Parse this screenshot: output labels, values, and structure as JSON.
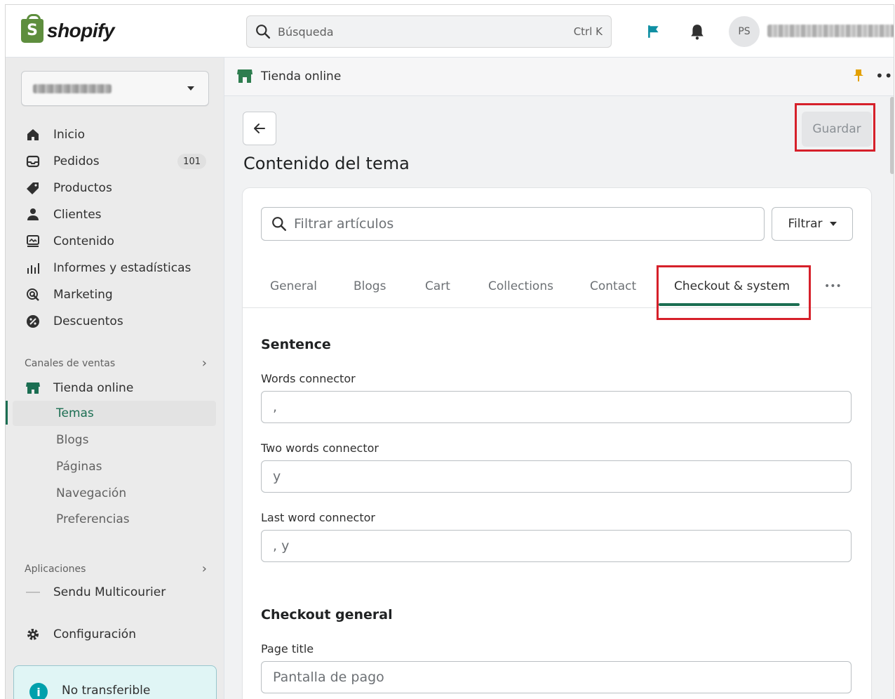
{
  "topbar": {
    "logo_text": "shopify",
    "logo_mark": "S",
    "search_placeholder": "Búsqueda",
    "search_shortcut": "Ctrl K",
    "avatar_initials": "PS",
    "accent": "#1b6e52"
  },
  "sidebar": {
    "items": [
      {
        "label": "Inicio",
        "icon": "home-icon"
      },
      {
        "label": "Pedidos",
        "icon": "orders-icon",
        "badge": "101"
      },
      {
        "label": "Productos",
        "icon": "tag-icon"
      },
      {
        "label": "Clientes",
        "icon": "person-icon"
      },
      {
        "label": "Contenido",
        "icon": "content-icon"
      },
      {
        "label": "Informes y estadísticas",
        "icon": "bar-chart-icon"
      },
      {
        "label": "Marketing",
        "icon": "target-icon"
      },
      {
        "label": "Descuentos",
        "icon": "discount-icon"
      }
    ],
    "sales_channels_label": "Canales de ventas",
    "online_store_label": "Tienda online",
    "sub_items": [
      "Temas",
      "Blogs",
      "Páginas",
      "Navegación",
      "Preferencias"
    ],
    "apps_label": "Aplicaciones",
    "app_item": "Sendu Multicourier",
    "settings_label": "Configuración",
    "banner_text": "No transferible"
  },
  "crumb": {
    "label": "Tienda online"
  },
  "page": {
    "title": "Contenido del tema",
    "save_label": "Guardar",
    "filter_placeholder": "Filtrar artículos",
    "filter_button": "Filtrar",
    "tabs": [
      "General",
      "Blogs",
      "Cart",
      "Collections",
      "Contact",
      "Checkout & system"
    ],
    "tabs_more": "•••",
    "active_tab": "Checkout & system",
    "sections": [
      {
        "title": "Sentence",
        "fields": [
          {
            "label": "Words connector",
            "value": ","
          },
          {
            "label": "Two words connector",
            "value": "y"
          },
          {
            "label": "Last word connector",
            "value": ", y"
          }
        ]
      },
      {
        "title": "Checkout general",
        "fields": [
          {
            "label": "Page title",
            "value": "Pantalla de pago"
          }
        ]
      }
    ]
  },
  "colors": {
    "highlight": "#d6202a",
    "brand_green": "#5e8e3e",
    "info": "#00a0ac"
  }
}
